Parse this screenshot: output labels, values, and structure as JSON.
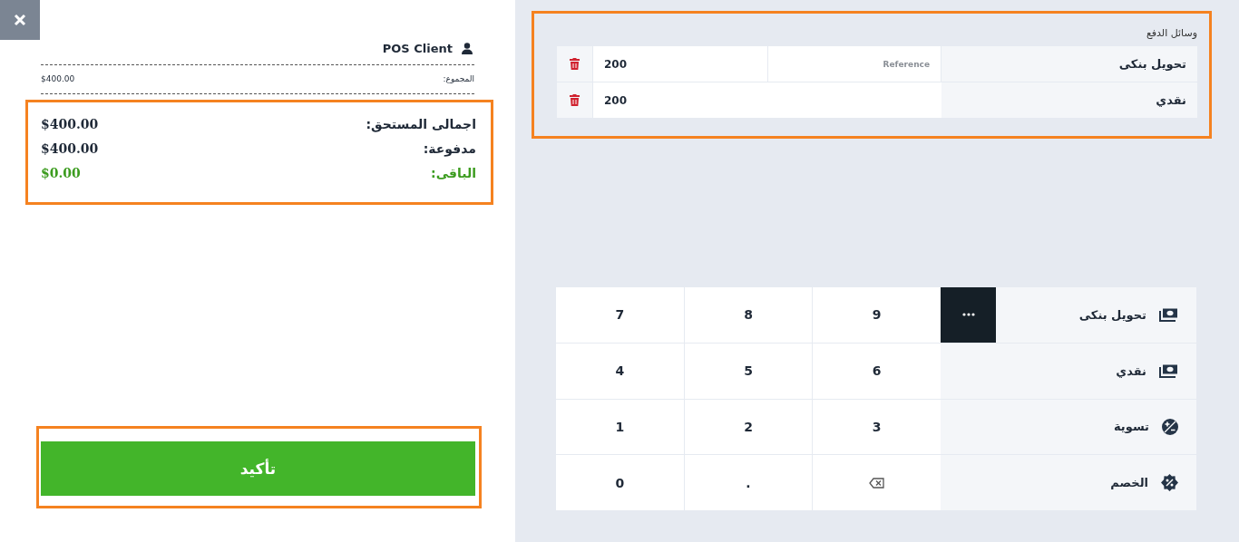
{
  "client": {
    "name": "POS Client"
  },
  "subtotal": {
    "label": "المجموع:",
    "value": "$400.00"
  },
  "summary": [
    {
      "kind": "normal",
      "label": "اجمالى المستحق:",
      "value": "$400.00"
    },
    {
      "kind": "normal",
      "label": "مدفوعة:",
      "value": "$400.00"
    },
    {
      "kind": "remaining",
      "label": "الباقى:",
      "value": "$0.00"
    }
  ],
  "confirm_button": {
    "label": "تأكيد"
  },
  "payment_lines": {
    "title": "وسائل الدفع",
    "rows": [
      {
        "method": "تحويل بنكى",
        "amount": "200",
        "reference_placeholder": "Reference"
      },
      {
        "method": "نقدي",
        "amount": "200"
      }
    ]
  },
  "keypad": [
    {
      "kind": "digit",
      "label": "9"
    },
    {
      "kind": "digit",
      "label": "8"
    },
    {
      "kind": "digit",
      "label": "7"
    },
    {
      "kind": "digit",
      "label": "6"
    },
    {
      "kind": "digit",
      "label": "5"
    },
    {
      "kind": "digit",
      "label": "4"
    },
    {
      "kind": "digit",
      "label": "3"
    },
    {
      "kind": "digit",
      "label": "2"
    },
    {
      "kind": "digit",
      "label": "1"
    },
    {
      "kind": "backspace"
    },
    {
      "kind": "digit",
      "label": "."
    },
    {
      "kind": "digit",
      "label": "0"
    }
  ],
  "methods": [
    {
      "label": "تحويل بنكى",
      "kind": "money",
      "menu": true
    },
    {
      "label": "نقدي",
      "kind": "money",
      "menu": false
    },
    {
      "label": "تسوية",
      "kind": "adjustment",
      "menu": false
    },
    {
      "label": "الخصم",
      "kind": "discount",
      "menu": false
    }
  ]
}
